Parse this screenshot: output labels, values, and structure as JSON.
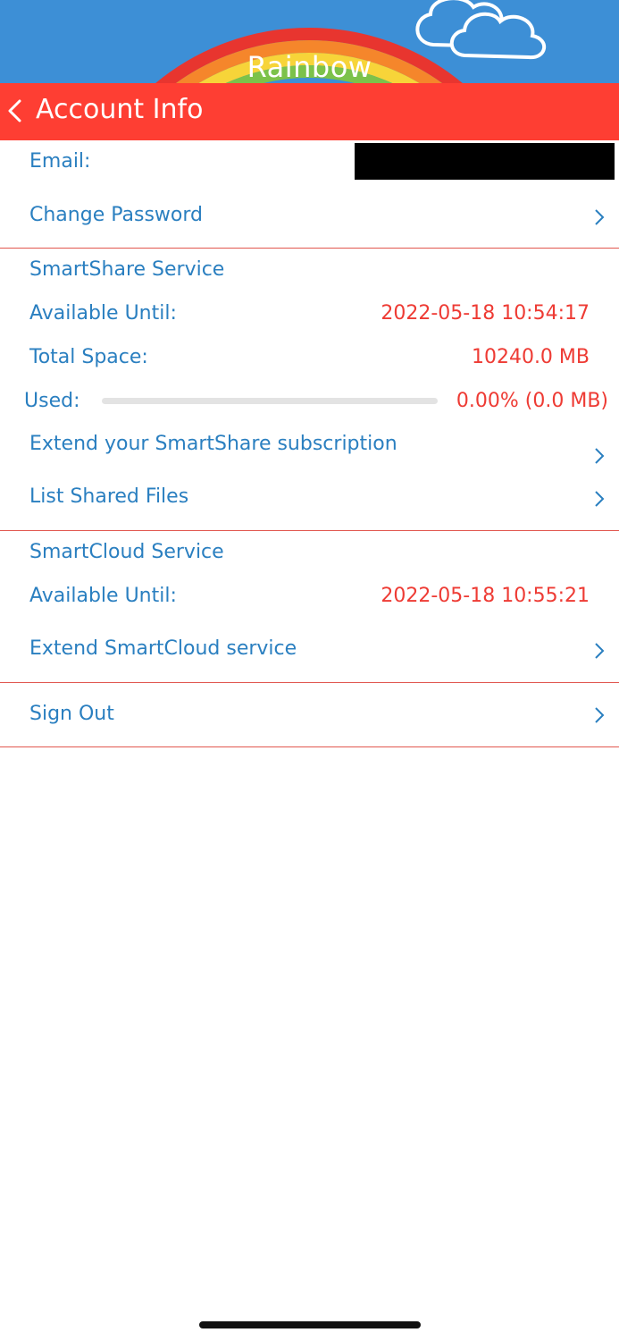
{
  "header": {
    "brand": "Rainbow",
    "title": "Account Info"
  },
  "account": {
    "email_label": "Email:",
    "change_password_label": "Change Password"
  },
  "smartshare": {
    "section_label": "SmartShare Service",
    "available_label": "Available Until:",
    "available_value": "2022-05-18 10:54:17",
    "total_space_label": "Total Space:",
    "total_space_value": "10240.0 MB",
    "used_label": "Used:",
    "used_value": "0.00% (0.0 MB)",
    "used_fraction": 0.0,
    "extend_label": "Extend your SmartShare subscription",
    "list_files_label": "List Shared Files"
  },
  "smartcloud": {
    "section_label": "SmartCloud Service",
    "available_label": "Available Until:",
    "available_value": "2022-05-18 10:55:21",
    "extend_label": "Extend SmartCloud service"
  },
  "sign_out_label": "Sign Out",
  "colors": {
    "nav_bar": "#fe3e33",
    "label_blue": "#2a7fc0",
    "value_red": "#ee3b34",
    "banner_sky": "#3d8fd6"
  }
}
